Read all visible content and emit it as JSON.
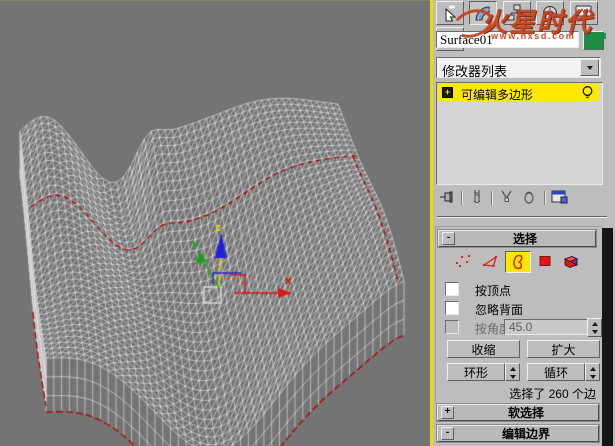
{
  "watermark": {
    "brand": "火星时代",
    "url": "www.hxsd.com"
  },
  "viewport": {
    "bg_color": "#747474",
    "wire_color": "#ffffff",
    "selection_color": "#b20000",
    "active_viewport_border_color": "#e6e200",
    "gizmo": {
      "x_label": "x",
      "y_label": "y",
      "z_label": "z",
      "x_color": "#d81818",
      "y_color": "#18a018",
      "z_color": "#2020d8",
      "active_axis_color": "#e8d400"
    }
  },
  "panel": {
    "tabs": [
      "create-tab-icon",
      "modify-tab-icon",
      "hierarchy-tab-icon",
      "motion-tab-icon",
      "display-tab-icon",
      "utilities-tab-icon"
    ],
    "active_tab": "modify",
    "object_name": "Surface01",
    "object_color": "#1d8c46",
    "modifier_list_label": "修改器列表",
    "modifier_stack": {
      "items": [
        {
          "expand": "+",
          "label": "可编辑多边形",
          "selected": true,
          "visibility_icon": "lightbulb-icon"
        }
      ]
    },
    "stack_toolbar_icons": [
      "pin-stack-icon",
      "show-end-result-icon",
      "make-unique-icon",
      "remove-modifier-icon",
      "configure-modifier-sets-icon"
    ],
    "selection_rollout": {
      "state": "-",
      "title": "选择",
      "subobject_icons": [
        {
          "name": "vertex",
          "active": false
        },
        {
          "name": "edge",
          "active": false
        },
        {
          "name": "border",
          "active": true
        },
        {
          "name": "polygon",
          "active": false
        },
        {
          "name": "element",
          "active": false
        }
      ],
      "checkboxes": [
        {
          "label": "按顶点",
          "checked": false,
          "enabled": true
        },
        {
          "label": "忽略背面",
          "checked": false,
          "enabled": true
        },
        {
          "label": "按角度:",
          "checked": false,
          "enabled": false
        }
      ],
      "angle_value": "45.0",
      "shrink_label": "收缩",
      "grow_label": "扩大",
      "ring_label": "环形",
      "loop_label": "循环",
      "status": "选择了 260 个边"
    },
    "rollouts": [
      {
        "state": "+",
        "title": "软选择"
      },
      {
        "state": "-",
        "title": "编辑边界"
      }
    ]
  }
}
